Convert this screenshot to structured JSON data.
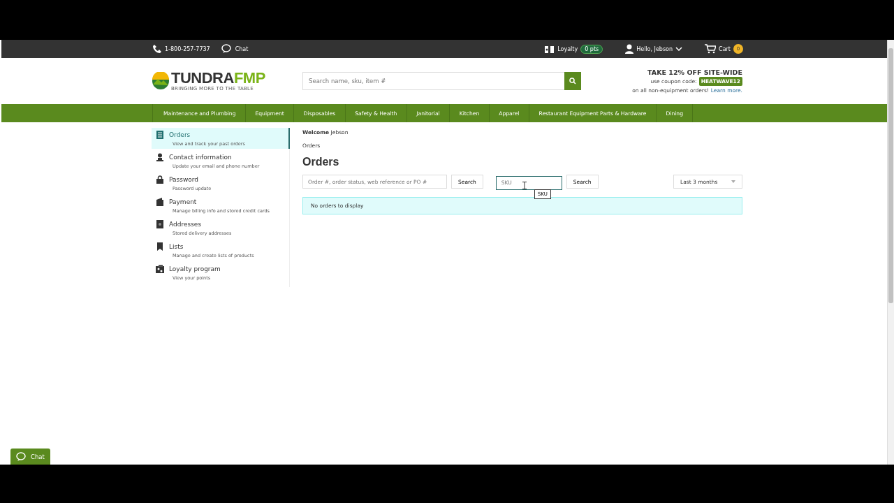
{
  "top_bar": {
    "phone": "1-800-257-7737",
    "chat": "Chat",
    "loyalty": "Loyalty",
    "points": "0 pts",
    "greeting": "Hello, Jebson",
    "cart": "Cart",
    "cart_count": "0"
  },
  "logo": {
    "name_first": "TUNDRA",
    "name_second": "FMP",
    "tagline": "BRINGING MORE TO THE TABLE"
  },
  "search": {
    "placeholder": "Search name, sku, item #"
  },
  "promo": {
    "headline": "TAKE 12% OFF SITE-WIDE",
    "code_label": "use coupon code:",
    "code": "HEATWAVE12",
    "note": "on all non-equipment orders!",
    "link": "Learn more."
  },
  "nav": [
    "Maintenance and Plumbing",
    "Equipment",
    "Disposables",
    "Safety & Health",
    "Janitorial",
    "Kitchen",
    "Apparel",
    "Restaurant Equipment Parts & Hardware",
    "Dining"
  ],
  "sidebar": {
    "items": [
      {
        "title": "Orders",
        "subtitle": "View and track your past orders",
        "selected": true
      },
      {
        "title": "Contact information",
        "subtitle": "Update your email and phone number",
        "selected": false
      },
      {
        "title": "Password",
        "subtitle": "Password update",
        "selected": false
      },
      {
        "title": "Payment",
        "subtitle": "Manage billing info and stored credit cards",
        "selected": false
      },
      {
        "title": "Addresses",
        "subtitle": "Stored delivery addresses",
        "selected": false
      },
      {
        "title": "Lists",
        "subtitle": "Manage and create lists of products",
        "selected": false
      },
      {
        "title": "Loyalty program",
        "subtitle": "View your points",
        "selected": false
      }
    ]
  },
  "main": {
    "welcome": "**Welcome** Jebson",
    "breadcrumb": "Orders",
    "heading": "Orders",
    "order_search": {
      "placeholder": "Order #, order status, web reference or PO #",
      "button": "Search"
    },
    "sku_search": {
      "placeholder": "SKU",
      "button": "Search",
      "tooltip": "SKU"
    },
    "period": {
      "value": "Last 3 months"
    },
    "alert": "No orders to display"
  },
  "chat_widget": {
    "label": "Chat"
  }
}
